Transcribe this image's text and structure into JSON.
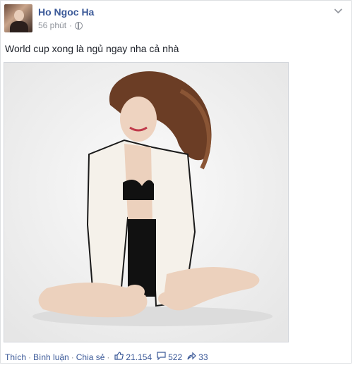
{
  "post": {
    "author": "Ho Ngoc Ha",
    "time": "56 phút",
    "separator": "·",
    "text": "World cup xong là ngủ ngay nha cả nhà",
    "actions": {
      "like": "Thích",
      "comment": "Bình luận",
      "share": "Chia sẻ",
      "dot": "·"
    },
    "stats": {
      "likes": "21.154",
      "comments": "522",
      "shares": "33"
    }
  },
  "colors": {
    "link": "#3b5998",
    "meta": "#90949c"
  },
  "icons": {
    "privacy": "globe-icon",
    "menu": "chevron-down-icon",
    "likes": "thumbs-up-icon",
    "comments": "comment-icon",
    "shares": "share-arrow-icon"
  }
}
